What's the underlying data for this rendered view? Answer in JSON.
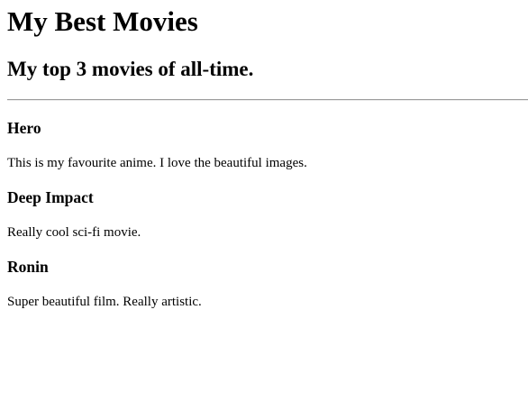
{
  "header": {
    "title": "My Best Movies",
    "subtitle": "My top 3 movies of all-time."
  },
  "movies": [
    {
      "title": "Hero",
      "description": "This is my favourite anime. I love the beautiful images."
    },
    {
      "title": "Deep Impact",
      "description": "Really cool sci-fi movie."
    },
    {
      "title": "Ronin",
      "description": "Super beautiful film. Really artistic."
    }
  ]
}
